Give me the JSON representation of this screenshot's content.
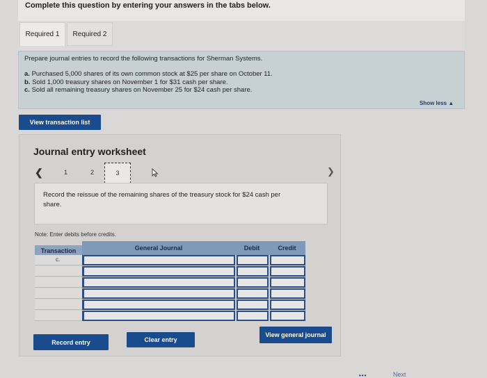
{
  "header": {
    "instruction": "Complete this question by entering your answers in the tabs below."
  },
  "tabs": [
    {
      "label": "Required 1"
    },
    {
      "label": "Required 2"
    }
  ],
  "info": {
    "lead": "Prepare journal entries to record the following transactions for Sherman Systems.",
    "items": [
      {
        "key": "a.",
        "text": "Purchased 5,000 shares of its own common stock at $25 per share on October 11."
      },
      {
        "key": "b.",
        "text": "Sold 1,000 treasury shares on November 1 for $31 cash per share."
      },
      {
        "key": "c.",
        "text": "Sold all remaining treasury shares on November 25 for $24 cash per share."
      }
    ]
  },
  "show_less": "Show less ▲",
  "buttons": {
    "view_transaction_list": "View transaction list",
    "record_entry": "Record entry",
    "clear_entry": "Clear entry",
    "view_general_journal": "View general journal"
  },
  "worksheet": {
    "title": "Journal entry worksheet",
    "pages": [
      "1",
      "2",
      "3"
    ],
    "current_page": "3",
    "prompt": "Record the reissue of the remaining shares of the treasury stock for $24 cash per share.",
    "note": "Note: Enter debits before credits.",
    "table": {
      "headers": {
        "transaction": "Transaction",
        "general_journal": "General Journal",
        "debit": "Debit",
        "credit": "Credit"
      },
      "rows": [
        {
          "transaction": "c."
        },
        {
          "transaction": ""
        },
        {
          "transaction": ""
        },
        {
          "transaction": ""
        },
        {
          "transaction": ""
        },
        {
          "transaction": ""
        }
      ]
    }
  },
  "footer": {
    "next_label": "Next"
  }
}
